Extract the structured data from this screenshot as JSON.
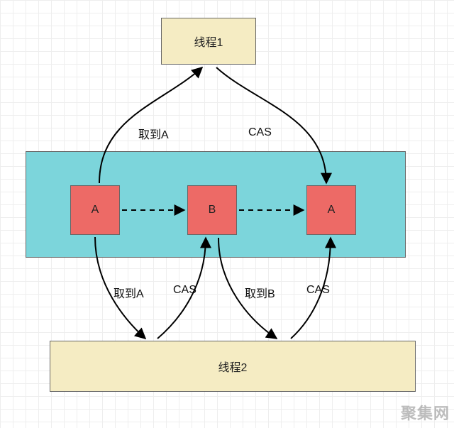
{
  "thread1": {
    "label": "线程1"
  },
  "thread2": {
    "label": "线程2"
  },
  "states": {
    "a1": "A",
    "b": "B",
    "a2": "A"
  },
  "arrowLabels": {
    "t1_getA": "取到A",
    "t1_cas": "CAS",
    "t2_getA": "取到A",
    "t2_casA": "CAS",
    "t2_getB": "取到B",
    "t2_casB": "CAS"
  },
  "watermark": "聚集网"
}
